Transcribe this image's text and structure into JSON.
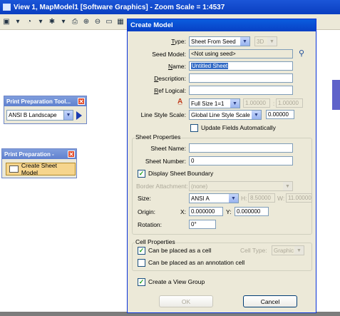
{
  "view": {
    "title": "View 1, MapModel1 [Software Graphics] - Zoom Scale = 1:4537",
    "toolbar_icons": [
      "view-attributes-icon",
      "render-icon",
      "lights-icon",
      "print-icon",
      "zoom-in-icon",
      "zoom-out-icon",
      "window-area-icon",
      "fit-view-icon",
      "rotate-icon"
    ]
  },
  "palette1": {
    "title": "Print Preparation Tool...",
    "paper_size": "ANSI B Landscape"
  },
  "palette2": {
    "title": "Print Preparation -",
    "create_button": "Create Sheet Model"
  },
  "dialog": {
    "title": "Create Model",
    "type_label": "Type:",
    "type_value": "Sheet From Seed",
    "dim_value": "3D",
    "seed_label": "Seed Model:",
    "seed_value": "<Not using seed>",
    "name_label": "Name:",
    "name_value": "Untitled Sheet",
    "desc_label": "Description:",
    "desc_value": "",
    "reflogical_label": "Ref Logical:",
    "reflogical_value": "",
    "annotation_scale": "Full Size 1=1",
    "scale_a": "1.00000",
    "scale_sep": ":",
    "scale_b": "1.00000",
    "linestyle_label": "Line Style Scale:",
    "linestyle_value": "Global Line Style Scale",
    "linestyle_num": "0.00000",
    "update_fields_label": "Update Fields Automatically",
    "update_fields_checked": false,
    "sheet_props_title": "Sheet Properties",
    "sheet_name_label": "Sheet Name:",
    "sheet_name_value": "",
    "sheet_number_label": "Sheet Number:",
    "sheet_number_value": "0",
    "display_boundary_label": "Display Sheet Boundary",
    "display_boundary_checked": true,
    "border_label": "Border Attachment:",
    "border_value": "(none)",
    "size_label": "Size:",
    "size_value": "ANSI A",
    "h_label": "H:",
    "h_value": "8.50000",
    "w_label": "W:",
    "w_value": "11.00000",
    "origin_label": "Origin:",
    "x_label": "X:",
    "x_value": "0.000000",
    "y_label": "Y:",
    "y_value": "0.000000",
    "rotation_label": "Rotation:",
    "rotation_value": "0°",
    "cell_props_title": "Cell Properties",
    "cell_label": "Can be placed as a cell",
    "cell_checked": true,
    "cell_type_label": "Cell Type:",
    "cell_type_value": "Graphic",
    "annot_cell_label": "Can be placed as an annotation cell",
    "annot_cell_checked": false,
    "view_group_label": "Create a View Group",
    "view_group_checked": true,
    "ok_label": "OK",
    "cancel_label": "Cancel"
  }
}
